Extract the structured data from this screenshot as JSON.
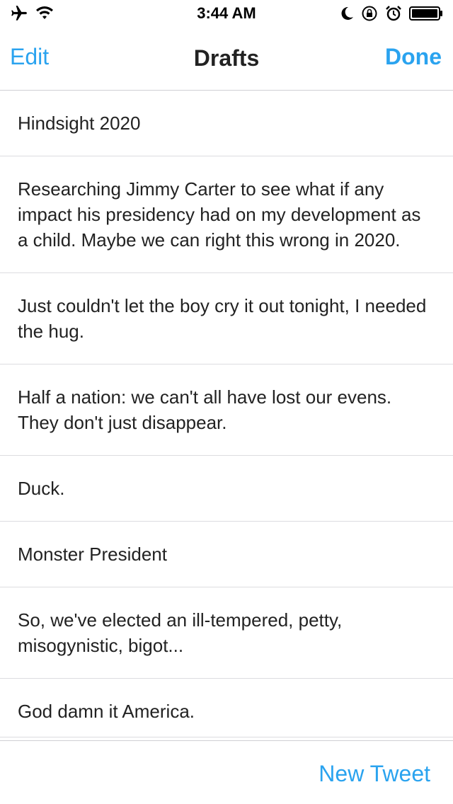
{
  "status_bar": {
    "time": "3:44 AM",
    "left_icons": [
      "airplane-icon",
      "wifi-icon"
    ],
    "right_icons": [
      "moon-icon",
      "rotation-lock-icon",
      "alarm-icon",
      "battery-icon"
    ]
  },
  "nav": {
    "edit_label": "Edit",
    "title": "Drafts",
    "done_label": "Done"
  },
  "drafts": [
    {
      "text": "Hindsight 2020"
    },
    {
      "text": "Researching Jimmy Carter to see what if any impact his presidency had on my development as a child. Maybe we can right this wrong in 2020."
    },
    {
      "text": "Just couldn't let the boy cry it out tonight, I needed the hug."
    },
    {
      "text": "Half a nation: we can't all have lost our evens. They don't just disappear."
    },
    {
      "text": "Duck."
    },
    {
      "text": "Monster President"
    },
    {
      "text": "So, we've elected an ill-tempered, petty, misogynistic, bigot..."
    },
    {
      "text": "God damn it America."
    }
  ],
  "toolbar": {
    "new_tweet_label": "New Tweet"
  },
  "colors": {
    "accent": "#2aa3ef",
    "text": "#222222",
    "separator": "#dcdce0"
  }
}
